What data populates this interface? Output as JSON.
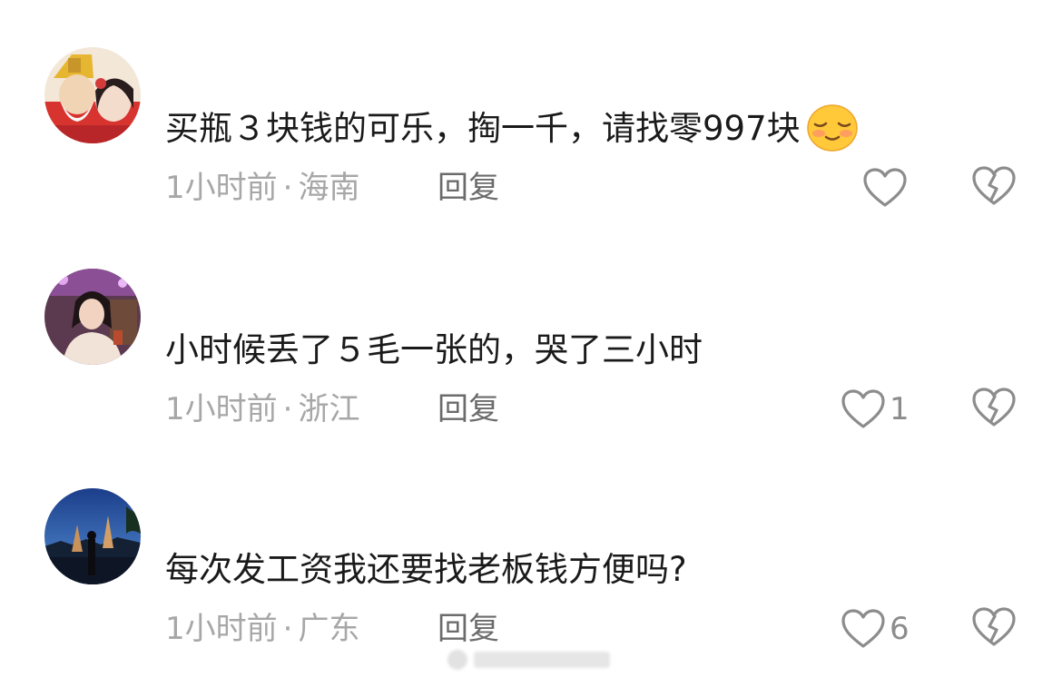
{
  "comments": [
    {
      "username": "",
      "text": "买瓶３块钱的可乐，掏一千，请找零997块",
      "time": "1小时前",
      "location": "海南",
      "reply_label": "回复",
      "likes": "",
      "emoji": "smiling-face-icon"
    },
    {
      "username": "",
      "text": "小时候丢了５毛一张的，哭了三小时",
      "time": "1小时前",
      "location": "浙江",
      "reply_label": "回复",
      "likes": "1"
    },
    {
      "username": "",
      "text": "每次发工资我还要找老板钱方便吗?",
      "time": "1小时前",
      "location": "广东",
      "reply_label": "回复",
      "likes": "6"
    }
  ],
  "meta_separator": "·",
  "icons": {
    "like": "heart-outline-icon",
    "dislike": "broken-heart-icon"
  },
  "colors": {
    "text": "#1a1a1a",
    "meta": "#a7a7a7",
    "reply": "#6b6b6b",
    "icon": "#8c8c8c"
  }
}
